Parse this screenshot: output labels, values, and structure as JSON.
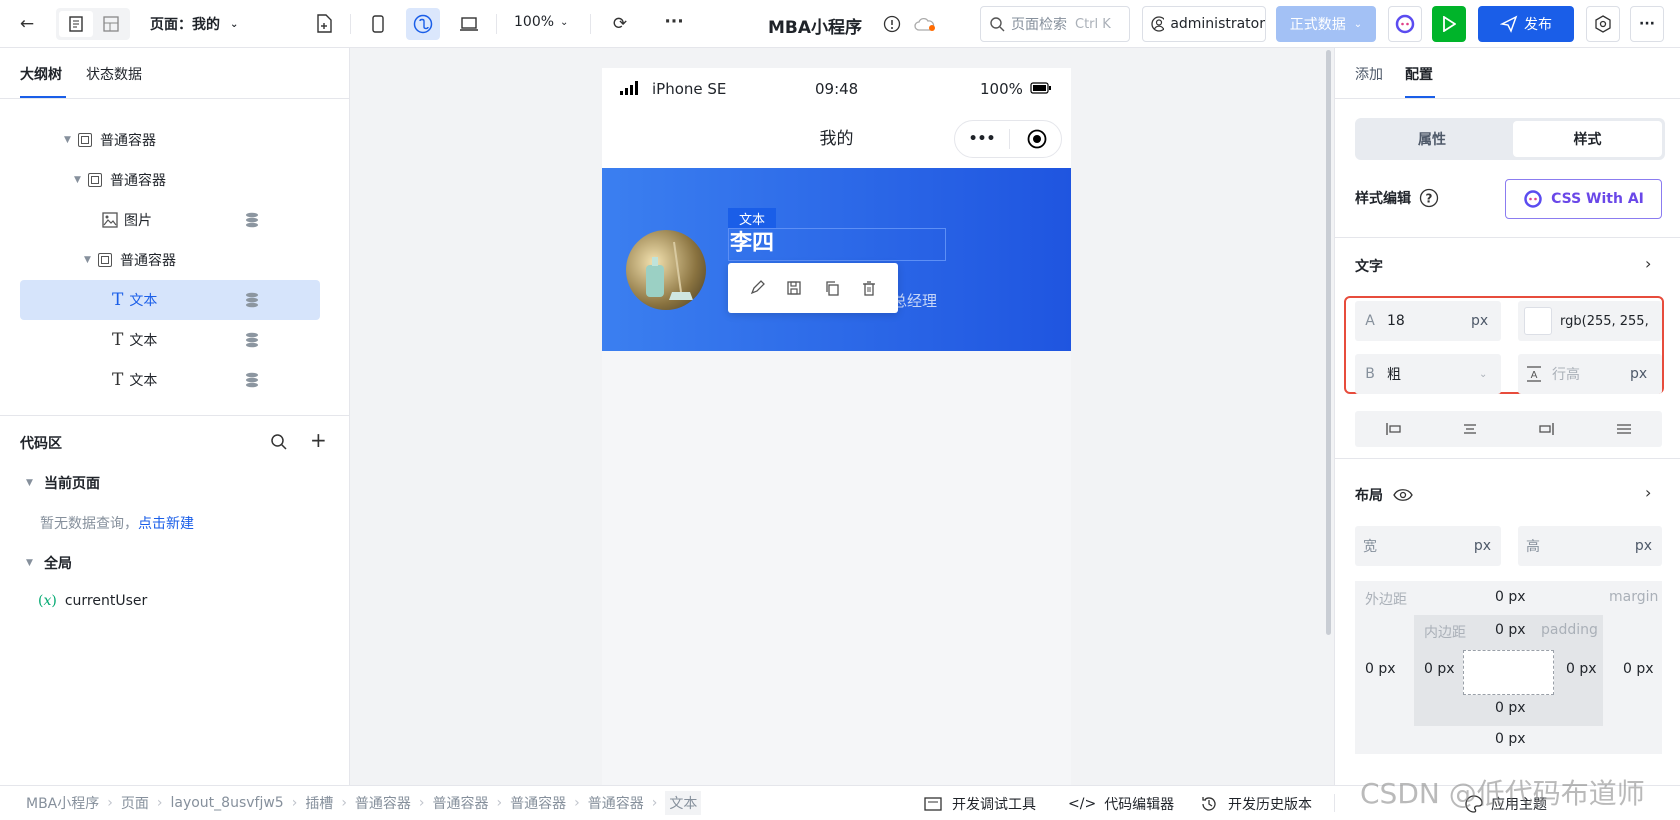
{
  "topbar": {
    "page_label": "页面：我的",
    "zoom": "100%",
    "app_title": "MBA小程序",
    "search_placeholder": "页面检索",
    "search_shortcut": "Ctrl K",
    "user": "administrator",
    "env": "正式数据",
    "publish": "发布"
  },
  "left": {
    "tabs": [
      "大纲树",
      "状态数据"
    ],
    "tree": [
      {
        "label": "普通容器",
        "icon": "container-icon"
      },
      {
        "label": "普通容器",
        "icon": "container-icon"
      },
      {
        "label": "图片",
        "icon": "image-icon"
      },
      {
        "label": "普通容器",
        "icon": "container-icon"
      },
      {
        "label": "文本",
        "icon": "text-icon"
      },
      {
        "label": "文本",
        "icon": "text-icon"
      },
      {
        "label": "文本",
        "icon": "text-icon"
      }
    ],
    "code": {
      "title": "代码区",
      "current_page": "当前页面",
      "empty_text": "暂无数据查询，",
      "new_link": "点击新建",
      "global": "全局",
      "var_prefix": "(𝑥)",
      "var_name": "currentUser"
    }
  },
  "phone": {
    "carrier": "iPhone SE",
    "time": "09:48",
    "battery": "100%",
    "nav_title": "我的",
    "name": "李四",
    "role_visible": "总经理",
    "sel_tag": "文本"
  },
  "right": {
    "tabs": [
      "添加",
      "配置"
    ],
    "seg": [
      "属性",
      "样式"
    ],
    "style_edit": "样式编辑",
    "css_ai": "CSS With AI",
    "text_section": "文字",
    "font_size_label": "A",
    "font_size": "18",
    "unit": "px",
    "color": "rgb(255, 255,",
    "weight_label": "B",
    "weight": "粗",
    "line_height_placeholder": "行高",
    "layout_section": "布局",
    "width_label": "宽",
    "height_label": "高",
    "margin_label": "外边距",
    "margin_en": "margin",
    "padding_label": "内边距",
    "padding_en": "padding",
    "zero_px": "0 px"
  },
  "bottom": {
    "breadcrumb": [
      "MBA小程序",
      "页面",
      "layout_8usvfjw5",
      "插槽",
      "普通容器",
      "普通容器",
      "普通容器",
      "普通容器",
      "文本"
    ],
    "dev_tools": "开发调试工具",
    "code_editor": "代码编辑器",
    "history": "开发历史版本",
    "theme": "应用主题",
    "watermark": "CSDN @低代码布道师"
  },
  "colors": {
    "primary": "#1a5ee8",
    "green": "#00b42a",
    "header_grad_start": "#3b7ff0",
    "header_grad_end": "#1f55e0",
    "highlight": "#e74c3c"
  }
}
